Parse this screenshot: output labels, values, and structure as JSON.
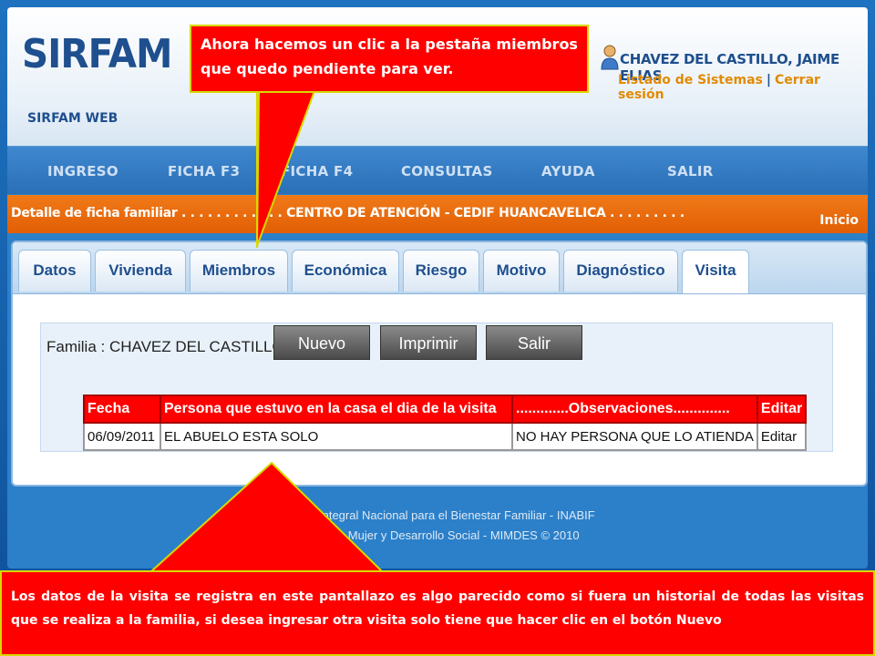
{
  "header": {
    "logo": "SIRFAM",
    "subtitle": "SIRFAM WEB",
    "user_name": "CHAVEZ DEL CASTILLO, JAIME ELIAS",
    "link_systems": "Listado de Sistemas",
    "separator": "|",
    "link_logout": "Cerrar sesión"
  },
  "nav": {
    "items": [
      "INGRESO",
      "FICHA F3",
      "FICHA F4",
      "CONSULTAS",
      "AYUDA",
      "SALIR"
    ]
  },
  "orange_bar": {
    "left_text": "Detalle de ficha familiar . . . . . . . . . . . . CENTRO DE ATENCIÓN - CEDIF HUANCAVELICA . . . . . . . . .",
    "right_text": "Inicio"
  },
  "tabs": {
    "items": [
      "Datos",
      "Vivienda",
      "Miembros",
      "Económica",
      "Riesgo",
      "Motivo",
      "Diagnóstico",
      "Visita"
    ],
    "active": "Visita"
  },
  "content": {
    "family_label": "Familia : CHAVEZ DEL CASTILLO",
    "buttons": {
      "new": "Nuevo",
      "print": "Imprimir",
      "exit": "Salir"
    }
  },
  "table": {
    "headers": [
      "Fecha",
      "Persona que estuvo en la casa el dia de la visita",
      ".............Observaciones..............",
      "Editar"
    ],
    "rows": [
      [
        "06/09/2011",
        "EL ABUELO ESTA SOLO",
        "NO HAY PERSONA QUE LO ATIENDA",
        "Editar"
      ]
    ]
  },
  "footer": {
    "line1": "Integral Nacional para el Bienestar Familiar - INABIF",
    "line2": "de la Mujer y Desarrollo Social - MIMDES © 2010"
  },
  "callouts": {
    "top": "Ahora hacemos un clic a la pestaña miembros que quedo pendiente para ver.",
    "bottom": "Los datos de la visita se registra en este pantallazo es algo parecido como si fuera un historial de todas las visitas que se realiza a la familia, si desea  ingresar otra visita solo tiene que hacer clic en el botón Nuevo"
  },
  "colors": {
    "callout": "#ff0000",
    "callout_border": "#d8d800",
    "orange_bar": "#e8680c",
    "brand_blue": "#1e4f8e",
    "table_header": "#ff0000"
  }
}
